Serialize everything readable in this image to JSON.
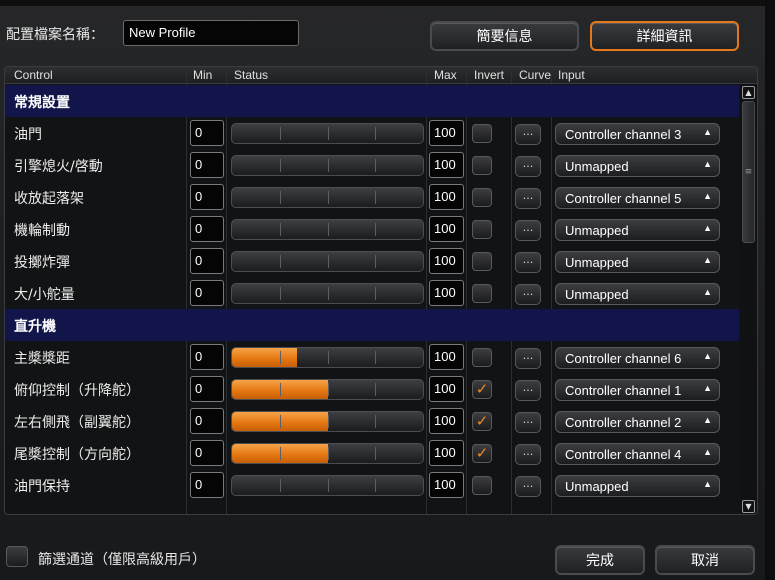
{
  "profile": {
    "label": "配置檔案名稱：",
    "value": "New Profile"
  },
  "tabs": {
    "summary": "簡要信息",
    "detail": "詳細資訊"
  },
  "columns": {
    "control": "Control",
    "min": "Min",
    "status": "Status",
    "max": "Max",
    "invert": "Invert",
    "curve": "Curve",
    "input": "Input"
  },
  "rows": [
    {
      "type": "section",
      "name": "常規設置"
    },
    {
      "type": "item",
      "name": "油門",
      "min": "0",
      "max": "100",
      "status": 0,
      "invert": false,
      "curve": "...",
      "input": "Controller channel 3"
    },
    {
      "type": "item",
      "name": "引擎熄火/啓動",
      "min": "0",
      "max": "100",
      "status": 0,
      "invert": false,
      "curve": "...",
      "input": "Unmapped"
    },
    {
      "type": "item",
      "name": "收放起落架",
      "min": "0",
      "max": "100",
      "status": 0,
      "invert": false,
      "curve": "...",
      "input": "Controller channel 5"
    },
    {
      "type": "item",
      "name": "機輪制動",
      "min": "0",
      "max": "100",
      "status": 0,
      "invert": false,
      "curve": "...",
      "input": "Unmapped"
    },
    {
      "type": "item",
      "name": "投擲炸彈",
      "min": "0",
      "max": "100",
      "status": 0,
      "invert": false,
      "curve": "...",
      "input": "Unmapped"
    },
    {
      "type": "item",
      "name": "大/小舵量",
      "min": "0",
      "max": "100",
      "status": 0,
      "invert": false,
      "curve": "...",
      "input": "Unmapped"
    },
    {
      "type": "section",
      "name": "直升機"
    },
    {
      "type": "item",
      "name": "主槳槳距",
      "min": "0",
      "max": "100",
      "status": 0.34,
      "invert": false,
      "curve": "...",
      "input": "Controller channel 6"
    },
    {
      "type": "item",
      "name": "俯仰控制（升降舵）",
      "min": "0",
      "max": "100",
      "status": 0.5,
      "invert": true,
      "curve": "...",
      "input": "Controller channel 1"
    },
    {
      "type": "item",
      "name": "左右側飛（副翼舵）",
      "min": "0",
      "max": "100",
      "status": 0.5,
      "invert": true,
      "curve": "...",
      "input": "Controller channel 2"
    },
    {
      "type": "item",
      "name": "尾槳控制（方向舵）",
      "min": "0",
      "max": "100",
      "status": 0.5,
      "invert": true,
      "curve": "...",
      "input": "Controller channel 4"
    },
    {
      "type": "item",
      "name": "油門保持",
      "min": "0",
      "max": "100",
      "status": 0,
      "invert": false,
      "curve": "...",
      "input": "Unmapped"
    }
  ],
  "footer": {
    "filter_label": "篩選通道（僅限高級用戶）",
    "ok": "完成",
    "cancel": "取消"
  },
  "colors": {
    "accent": "#e4781c",
    "section_bg": "#11154a",
    "status_fill": "#f08a2a"
  },
  "icons": {
    "check": "checkmark-icon",
    "dropdown": "triangle-up-icon",
    "scroll_up": "triangle-up-icon",
    "scroll_down": "triangle-down-icon"
  }
}
